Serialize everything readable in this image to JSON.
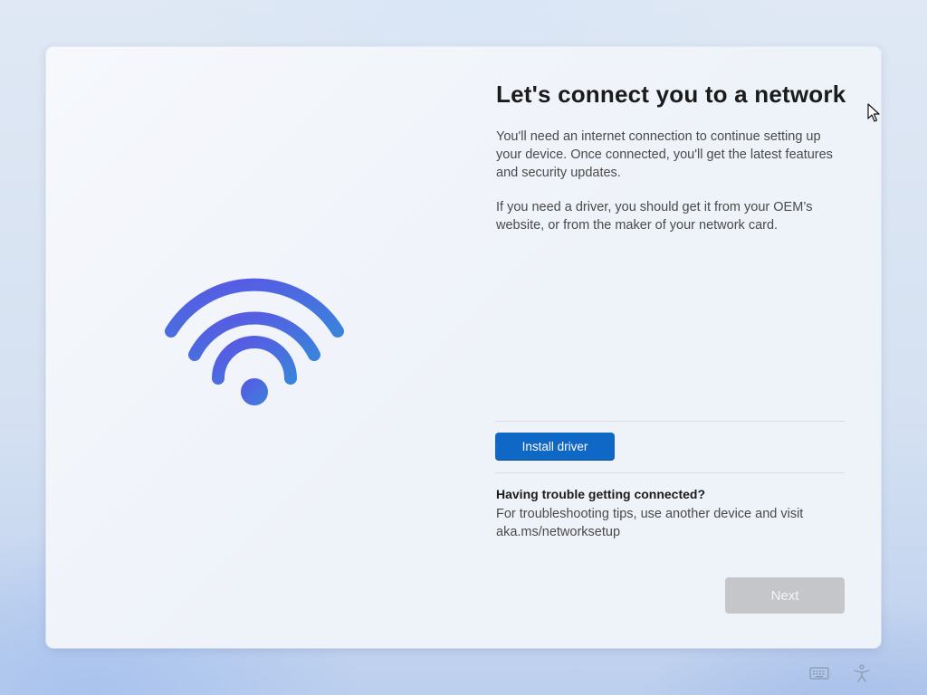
{
  "page": {
    "title": "Let's connect you to a network",
    "description": "You'll need an internet connection to continue setting up your device. Once connected, you'll get the latest features and security updates.",
    "driver_note": "If you need a driver, you should get it from your OEM’s website, or from the maker of your network card."
  },
  "buttons": {
    "install_driver": "Install driver",
    "next": "Next"
  },
  "troubleshooting": {
    "heading": "Having trouble getting connected?",
    "text": "For troubleshooting tips, use another device and visit aka.ms/networksetup"
  },
  "icons": {
    "illustration": "wifi-icon",
    "tray": [
      "keyboard-icon",
      "accessibility-icon"
    ],
    "pointer": "mouse-cursor-icon"
  },
  "colors": {
    "primary_button": "#0f67c6",
    "disabled_button": "#c4c6ca",
    "wifi_gradient_start": "#4f5ee6",
    "wifi_gradient_end": "#3a7fdc"
  }
}
